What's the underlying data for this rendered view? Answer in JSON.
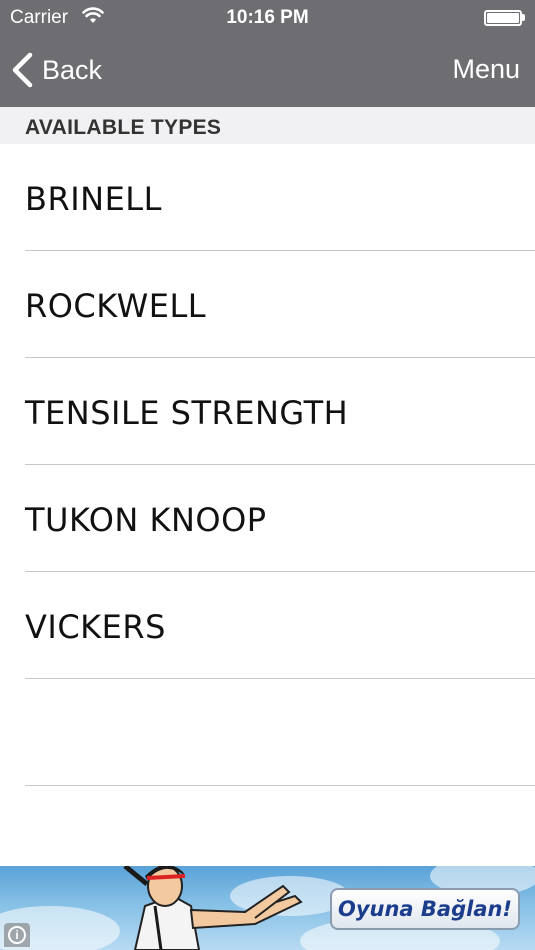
{
  "status_bar": {
    "carrier": "Carrier",
    "time": "10:16 PM"
  },
  "nav": {
    "back_label": "Back",
    "menu_label": "Menu"
  },
  "section": {
    "title": "AVAILABLE TYPES"
  },
  "list": {
    "items": [
      {
        "label": "BRINELL"
      },
      {
        "label": "ROCKWELL"
      },
      {
        "label": "TENSILE STRENGTH"
      },
      {
        "label": "TUKON KNOOP"
      },
      {
        "label": "VICKERS"
      }
    ]
  },
  "ad": {
    "cta_label": "Oyuna Bağlan!",
    "info_icon": "info-icon"
  },
  "colors": {
    "nav_background": "#6d6d72",
    "section_background": "#f1f1f3",
    "separator": "#c8c7cc"
  }
}
